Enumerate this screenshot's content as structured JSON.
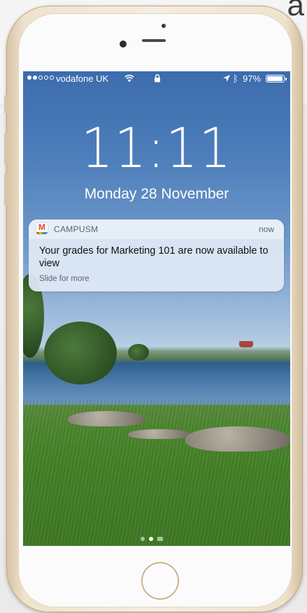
{
  "status_bar": {
    "carrier": "vodafone UK",
    "signal_bars_filled": 2,
    "signal_bars_total": 5,
    "battery_percent": "97%",
    "battery_level": 0.97,
    "icons": [
      "wifi-icon",
      "lock-icon",
      "location-arrow-icon",
      "bluetooth-icon",
      "battery-icon"
    ]
  },
  "lock_screen": {
    "time": "11:11",
    "date": "Monday 28 November"
  },
  "notification": {
    "app_name": "CAMPUSM",
    "time": "now",
    "message": "Your grades for Marketing 101 are now available to view",
    "action_hint": "Slide for more",
    "app_icon_letter": "M"
  },
  "page_indicator": {
    "pages": 3,
    "active_index": 1
  },
  "colors": {
    "notification_bg": "#e1eaf6",
    "phone_frame": "#efe3cd",
    "home_button_ring": "#c9b48f"
  }
}
